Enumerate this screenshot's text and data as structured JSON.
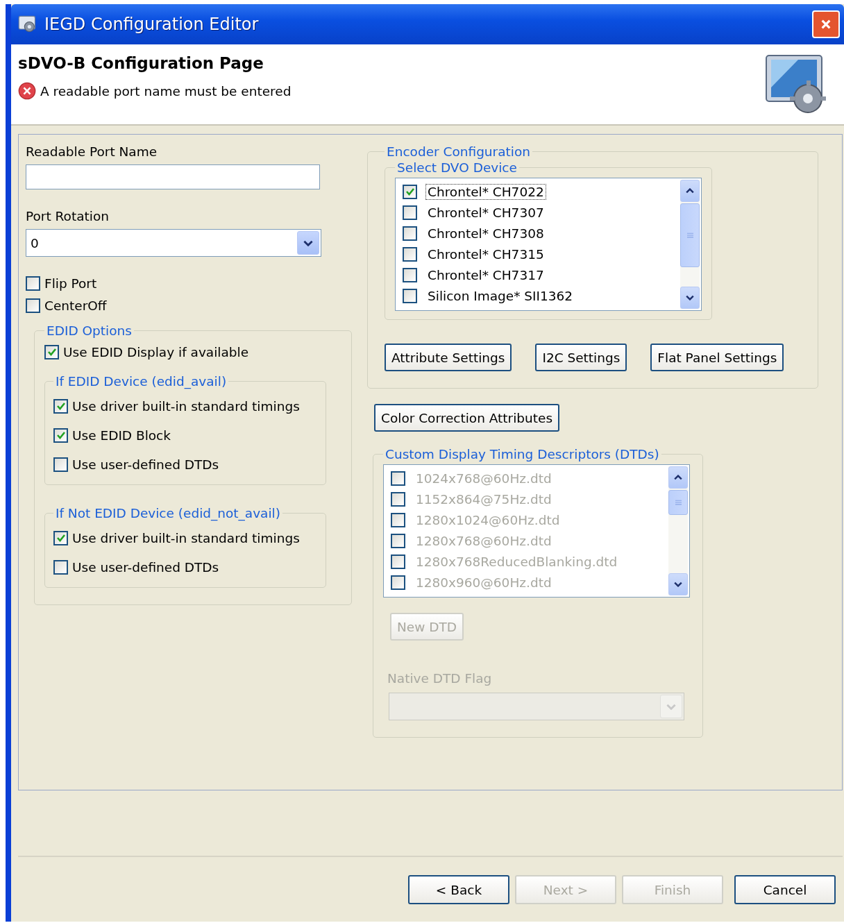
{
  "window": {
    "title": "IEGD Configuration Editor"
  },
  "header": {
    "title": "sDVO-B Configuration Page",
    "error": "A readable port name must be entered"
  },
  "port_name": {
    "label": "Readable Port Name"
  },
  "port_rotation": {
    "label": "Port Rotation",
    "value": "0"
  },
  "port_options": [
    {
      "label": "Flip Port",
      "checked": false
    },
    {
      "label": "CenterOff",
      "checked": false
    }
  ],
  "edid_options": {
    "title": "EDID Options",
    "use_edid": {
      "label": "Use EDID Display if available",
      "checked": true
    },
    "groups": [
      {
        "title": "If EDID Device (edid_avail)",
        "items": [
          {
            "label": "Use driver built-in standard timings",
            "checked": true
          },
          {
            "label": "Use EDID Block",
            "checked": true
          },
          {
            "label": "Use user-defined DTDs",
            "checked": false
          }
        ]
      },
      {
        "title": "If Not EDID Device (edid_not_avail)",
        "items": [
          {
            "label": "Use driver built-in standard timings",
            "checked": true
          },
          {
            "label": "Use user-defined DTDs",
            "checked": false
          }
        ]
      }
    ]
  },
  "encoder": {
    "title": "Encoder Configuration",
    "dvo_title": "Select DVO Device",
    "devices": [
      {
        "label": "Chrontel* CH7022",
        "checked": true,
        "focused": true
      },
      {
        "label": "Chrontel* CH7307",
        "checked": false,
        "focused": false
      },
      {
        "label": "Chrontel* CH7308",
        "checked": false,
        "focused": false
      },
      {
        "label": "Chrontel* CH7315",
        "checked": false,
        "focused": false
      },
      {
        "label": "Chrontel* CH7317",
        "checked": false,
        "focused": false
      },
      {
        "label": "Silicon Image* SII1362",
        "checked": false,
        "focused": false
      }
    ],
    "buttons": [
      "Attribute Settings",
      "I2C Settings",
      "Flat Panel Settings"
    ]
  },
  "color_correction_button": "Color Correction Attributes",
  "dtds": {
    "title": "Custom Display Timing Descriptors (DTDs)",
    "disabled": true,
    "items": [
      {
        "label": "1024x768@60Hz.dtd",
        "checked": false
      },
      {
        "label": "1152x864@75Hz.dtd",
        "checked": false
      },
      {
        "label": "1280x1024@60Hz.dtd",
        "checked": false
      },
      {
        "label": "1280x768@60Hz.dtd",
        "checked": false
      },
      {
        "label": "1280x768ReducedBlanking.dtd",
        "checked": false
      },
      {
        "label": "1280x960@60Hz.dtd",
        "checked": false
      }
    ],
    "new_button": "New DTD",
    "native_flag_label": "Native DTD Flag"
  },
  "footer_buttons": [
    {
      "label": "< Back",
      "disabled": false
    },
    {
      "label": "Next >",
      "disabled": true
    },
    {
      "label": "Finish",
      "disabled": true
    },
    {
      "label": "Cancel",
      "disabled": false
    }
  ]
}
